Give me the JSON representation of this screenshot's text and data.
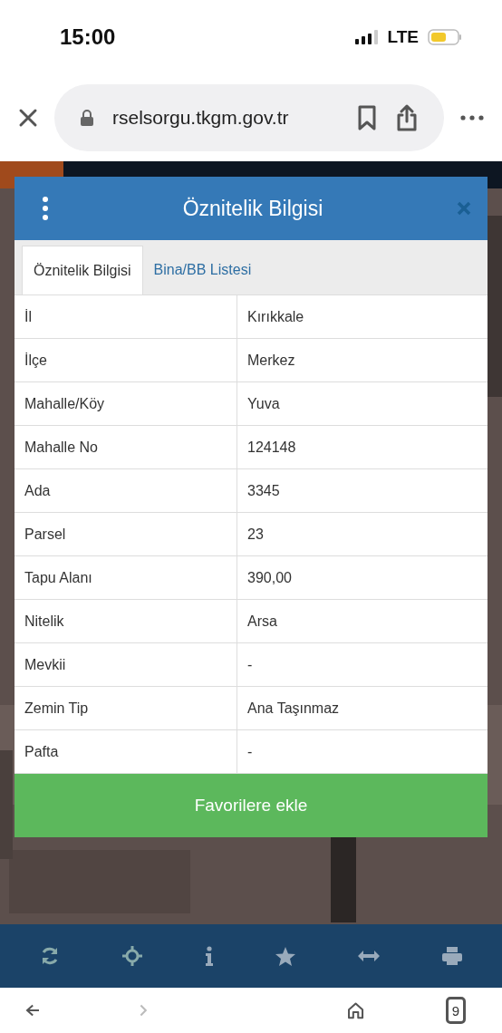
{
  "status_bar": {
    "time": "15:00",
    "network": "LTE"
  },
  "browser": {
    "url": "rselsorgu.tkgm.gov.tr",
    "tab_count": "9"
  },
  "dialog": {
    "title": "Öznitelik Bilgisi",
    "tabs": [
      {
        "label": "Öznitelik Bilgisi",
        "selected": true
      },
      {
        "label": "Bina/BB Listesi",
        "selected": false
      }
    ],
    "rows": [
      {
        "label": "İl",
        "value": "Kırıkkale"
      },
      {
        "label": "İlçe",
        "value": "Merkez"
      },
      {
        "label": "Mahalle/Köy",
        "value": "Yuva"
      },
      {
        "label": "Mahalle No",
        "value": "124148"
      },
      {
        "label": "Ada",
        "value": "3345"
      },
      {
        "label": "Parsel",
        "value": "23"
      },
      {
        "label": "Tapu Alanı",
        "value": "390,00"
      },
      {
        "label": "Nitelik",
        "value": "Arsa"
      },
      {
        "label": "Mevkii",
        "value": "-"
      },
      {
        "label": "Zemin Tip",
        "value": "Ana Taşınmaz"
      },
      {
        "label": "Pafta",
        "value": "-"
      }
    ],
    "button": "Favorilere ekle"
  },
  "toolbar": [
    {
      "kind": "refresh"
    },
    {
      "kind": "locate"
    },
    {
      "kind": "info"
    },
    {
      "kind": "star"
    },
    {
      "kind": "measure"
    },
    {
      "kind": "print"
    }
  ]
}
